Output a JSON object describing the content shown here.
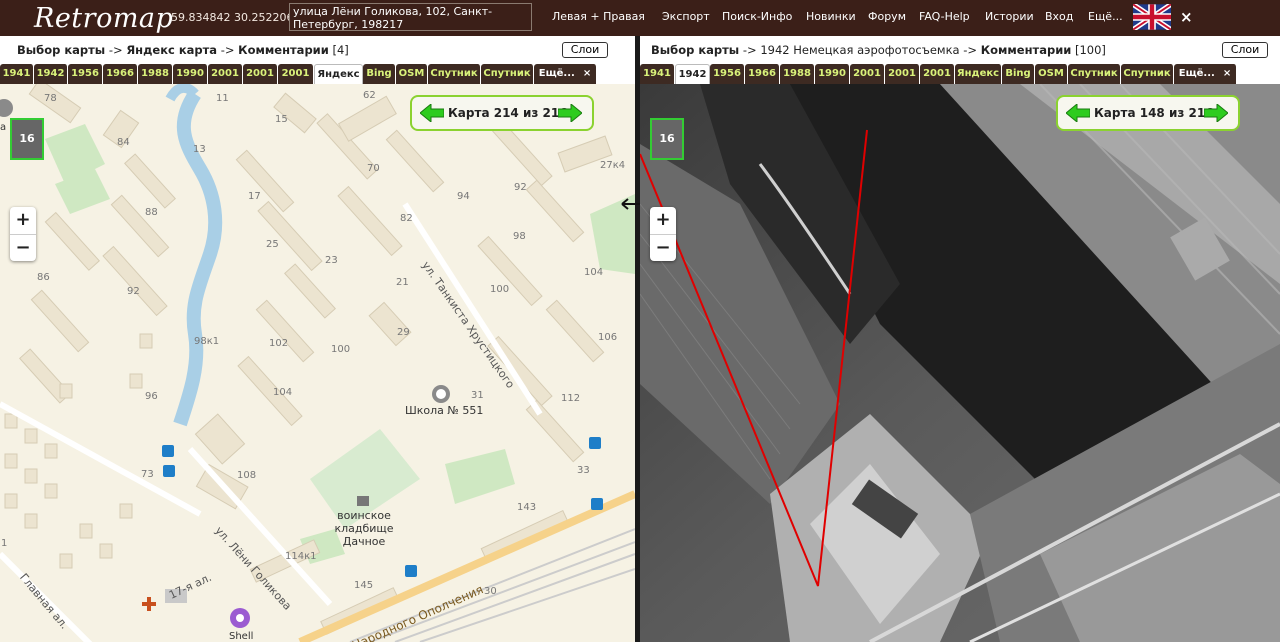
{
  "header": {
    "logo": "Retromap",
    "coords": "59.834842  30.252206",
    "address": "улица Лёни Голикова, 102, Санкт-Петербург, 198217",
    "menu": [
      "Левая + Правая",
      "Экспорт",
      "Поиск-Инфо",
      "Новинки",
      "Форум",
      "FAQ-Help",
      "Истории",
      "Вход",
      "Ещё..."
    ],
    "close": "×"
  },
  "left": {
    "crumb_select": "Выбор карты",
    "sep": " -> ",
    "crumb_map": "Яндекс карта",
    "crumb_comments": "Комментарии",
    "comments_count": "[4]",
    "layers": "Слои",
    "tabs": [
      "1941",
      "1942",
      "1956",
      "1966",
      "1988",
      "1990",
      "2001",
      "2001",
      "2001",
      "Яндекс",
      "Bing",
      "OSM",
      "Спутник",
      "Спутник",
      "Ещё..."
    ],
    "tab_close": "×",
    "zoom": "16",
    "zoom_in": "+",
    "zoom_out": "−",
    "nav_label": "Карта 214 из 216",
    "house_numbers": [
      "78",
      "11",
      "62",
      "15",
      "84",
      "13",
      "70",
      "27к4",
      "92",
      "88",
      "17",
      "94",
      "82",
      "98",
      "25",
      "23",
      "21",
      "104",
      "86",
      "92",
      "100",
      "29",
      "106",
      "98к1",
      "102",
      "100",
      "31",
      "96",
      "104",
      "112",
      "108",
      "33",
      "73",
      "143",
      "114к1",
      "145",
      "30",
      "1"
    ],
    "streets": [
      "ул. Танкиста Хрустицкого",
      "ул. Лёни Голикова",
      "Главная ал.",
      "17-я ал.",
      "Народного Ополчения"
    ],
    "pois": {
      "school": "Школа № 551",
      "cemetery": "воинское кладбище Дачное",
      "shell": "Shell",
      "left_edge": "а 1"
    }
  },
  "right": {
    "crumb_select": "Выбор карты",
    "sep": " -> ",
    "crumb_map": "1942 Немецкая аэрофотосъемка",
    "crumb_comments": "Комментарии",
    "comments_count": "[100]",
    "layers": "Слои",
    "tabs": [
      "1941",
      "1942",
      "1956",
      "1966",
      "1988",
      "1990",
      "2001",
      "2001",
      "2001",
      "Яндекс",
      "Bing",
      "OSM",
      "Спутник",
      "Спутник",
      "Ещё..."
    ],
    "tab_close": "×",
    "zoom": "16",
    "zoom_in": "+",
    "zoom_out": "−",
    "nav_label": "Карта 148 из 216"
  },
  "colors": {
    "topbar": "#3b1f18",
    "tab_bg": "#3d2a22",
    "tab_text": "#d9f27a",
    "nav_border": "#8bd230",
    "nav_arrow": "#2ecc1f",
    "map_bg": "#f6f2e4",
    "building": "#ece4d0",
    "water": "#a9cfe6",
    "park": "#cfe8c2",
    "view_line": "#e00000"
  }
}
